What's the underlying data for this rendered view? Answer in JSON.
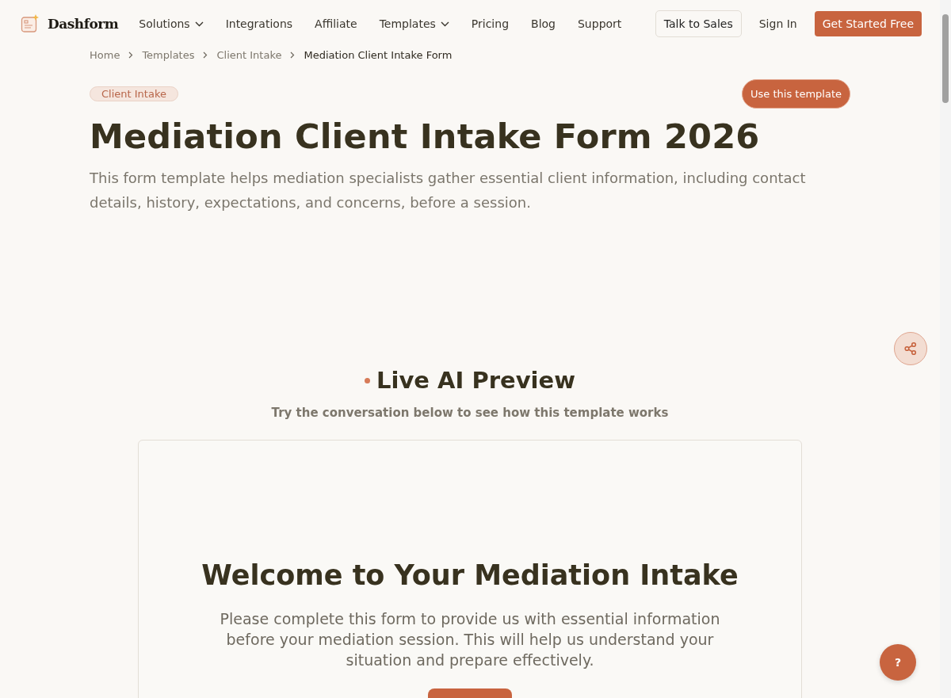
{
  "brand": "Dashform",
  "nav": [
    {
      "label": "Solutions",
      "dropdown": true
    },
    {
      "label": "Integrations",
      "dropdown": false
    },
    {
      "label": "Affiliate",
      "dropdown": false
    },
    {
      "label": "Templates",
      "dropdown": true
    },
    {
      "label": "Pricing",
      "dropdown": false
    },
    {
      "label": "Blog",
      "dropdown": false
    },
    {
      "label": "Support",
      "dropdown": false
    }
  ],
  "actions": {
    "sales": "Talk to Sales",
    "sign_in": "Sign In",
    "cta": "Get Started Free"
  },
  "breadcrumb": [
    {
      "label": "Home",
      "current": false
    },
    {
      "label": "Templates",
      "current": false
    },
    {
      "label": "Client Intake",
      "current": false
    },
    {
      "label": "Mediation Client Intake Form",
      "current": true
    }
  ],
  "category_tag": "Client Intake",
  "use_button": "Use this template",
  "title": "Mediation Client Intake Form 2026",
  "description": "This form template helps mediation specialists gather essential client information, including contact details, history, expectations, and concerns, before a session.",
  "preview": {
    "heading": "Live AI Preview",
    "subheading": "Try the conversation below to see how this template works",
    "card_title": "Welcome to Your Mediation Intake",
    "card_text": "Please complete this form to provide us with essential information before your mediation session. This will help us understand your situation and prepare effectively."
  },
  "help_button": "?"
}
